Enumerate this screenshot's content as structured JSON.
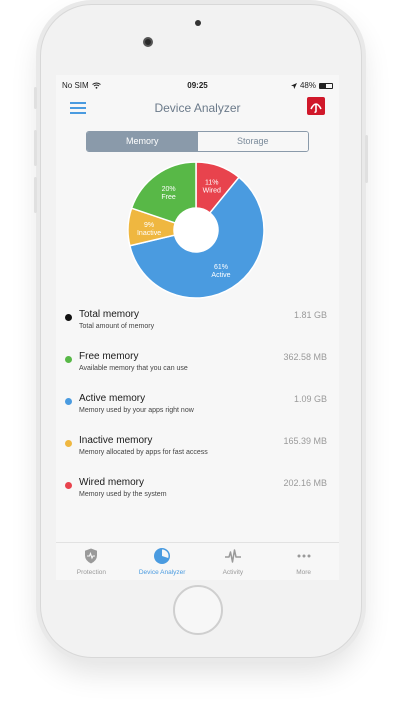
{
  "status_bar": {
    "carrier": "No SIM",
    "time": "09:25",
    "battery": "48%",
    "battery_level": 0.48
  },
  "nav": {
    "title": "Device Analyzer",
    "menu_icon": "hamburger-menu-icon",
    "brand_icon": "avira-umbrella-icon"
  },
  "segments": [
    {
      "label": "Memory",
      "active": true
    },
    {
      "label": "Storage",
      "active": false
    }
  ],
  "chart_data": {
    "type": "pie",
    "style": "donut",
    "slices": [
      {
        "label": "Wired",
        "percent": 11,
        "display": "11%",
        "color": "#e8434d"
      },
      {
        "label": "Active",
        "percent": 61,
        "display": "61%",
        "color": "#4a9be0"
      },
      {
        "label": "Inactive",
        "percent": 9,
        "display": "9%",
        "color": "#efb740"
      },
      {
        "label": "Free",
        "percent": 20,
        "display": "20%",
        "color": "#58b847"
      }
    ]
  },
  "memory_list": [
    {
      "title": "Total memory",
      "subtitle": "Total amount of memory",
      "value": "1.81 GB",
      "color": "#111111"
    },
    {
      "title": "Free memory",
      "subtitle": "Available memory that you can use",
      "value": "362.58 MB",
      "color": "#58b847"
    },
    {
      "title": "Active memory",
      "subtitle": "Memory used by your apps right now",
      "value": "1.09 GB",
      "color": "#4a9be0"
    },
    {
      "title": "Inactive memory",
      "subtitle": "Memory allocated by apps for fast access",
      "value": "165.39 MB",
      "color": "#efb740"
    },
    {
      "title": "Wired memory",
      "subtitle": "Memory used by the system",
      "value": "202.16 MB",
      "color": "#e8434d"
    }
  ],
  "tabs": [
    {
      "label": "Protection",
      "icon": "shield-icon",
      "active": false
    },
    {
      "label": "Device Analyzer",
      "icon": "pie-chart-icon",
      "active": true
    },
    {
      "label": "Activity",
      "icon": "pulse-icon",
      "active": false
    },
    {
      "label": "More",
      "icon": "ellipsis-icon",
      "active": false
    }
  ]
}
